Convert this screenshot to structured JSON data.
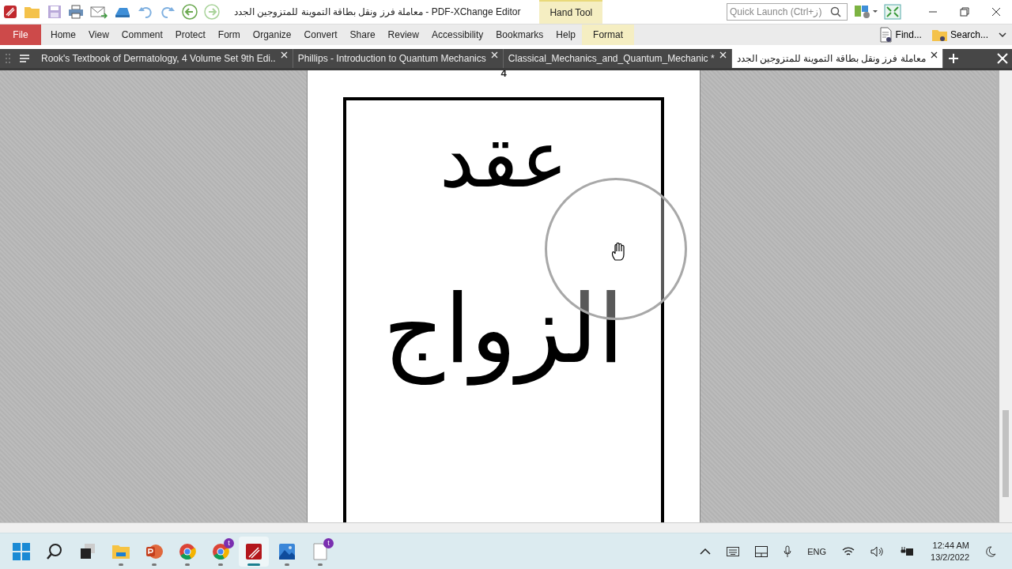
{
  "window": {
    "title": "معاملة فرز ونقل بطاقة التموينة للمتزوجين الجدد - PDF-XChange Editor",
    "context_tab": "Hand Tool"
  },
  "quick_launch": {
    "placeholder": "Quick Launch (Ctrl+ز)"
  },
  "menu": [
    {
      "label": "File",
      "kind": "file"
    },
    {
      "label": "Home",
      "kind": "plain"
    },
    {
      "label": "View",
      "kind": "plain"
    },
    {
      "label": "Comment",
      "kind": "plain"
    },
    {
      "label": "Protect",
      "kind": "plain"
    },
    {
      "label": "Form",
      "kind": "plain"
    },
    {
      "label": "Organize",
      "kind": "plain"
    },
    {
      "label": "Convert",
      "kind": "plain"
    },
    {
      "label": "Share",
      "kind": "plain"
    },
    {
      "label": "Review",
      "kind": "plain"
    },
    {
      "label": "Accessibility",
      "kind": "plain"
    },
    {
      "label": "Bookmarks",
      "kind": "plain"
    },
    {
      "label": "Help",
      "kind": "plain"
    },
    {
      "label": "Format",
      "kind": "context"
    }
  ],
  "ribbon_actions": [
    {
      "label": "Find...",
      "kind": "find"
    },
    {
      "label": "Search...",
      "kind": "search"
    }
  ],
  "tabs": [
    {
      "label": "Rook's Textbook of Dermatology, 4 Volume Set 9th Edi..",
      "selected": false
    },
    {
      "label": "Phillips - Introduction to Quantum Mechanics",
      "selected": false
    },
    {
      "label": "Classical_Mechanics_and_Quantum_Mechanic *",
      "selected": false
    },
    {
      "label": "معاملة فرز ونقل بطاقة التموينة للمتزوجين الجدد",
      "selected": true
    }
  ],
  "document": {
    "page_number": "4",
    "lines": [
      "عقد",
      "الزواج"
    ]
  },
  "taskbar": {
    "apps": [
      {
        "kind": "start",
        "running": false,
        "selected": false
      },
      {
        "kind": "search",
        "running": false,
        "selected": false
      },
      {
        "kind": "taskview",
        "running": false,
        "selected": false
      },
      {
        "kind": "explorer",
        "running": true,
        "selected": false
      },
      {
        "kind": "powerpoint",
        "running": true,
        "selected": false
      },
      {
        "kind": "chrome",
        "running": true,
        "selected": false
      },
      {
        "kind": "chrome",
        "running": true,
        "selected": false,
        "badge": "t"
      },
      {
        "kind": "pdf",
        "running": true,
        "selected": true
      },
      {
        "kind": "photos",
        "running": true,
        "selected": false
      },
      {
        "kind": "notepad",
        "running": true,
        "selected": false,
        "badge": "t"
      }
    ],
    "language": "ENG",
    "time": "12:44 AM",
    "date": "13/2/2022"
  }
}
